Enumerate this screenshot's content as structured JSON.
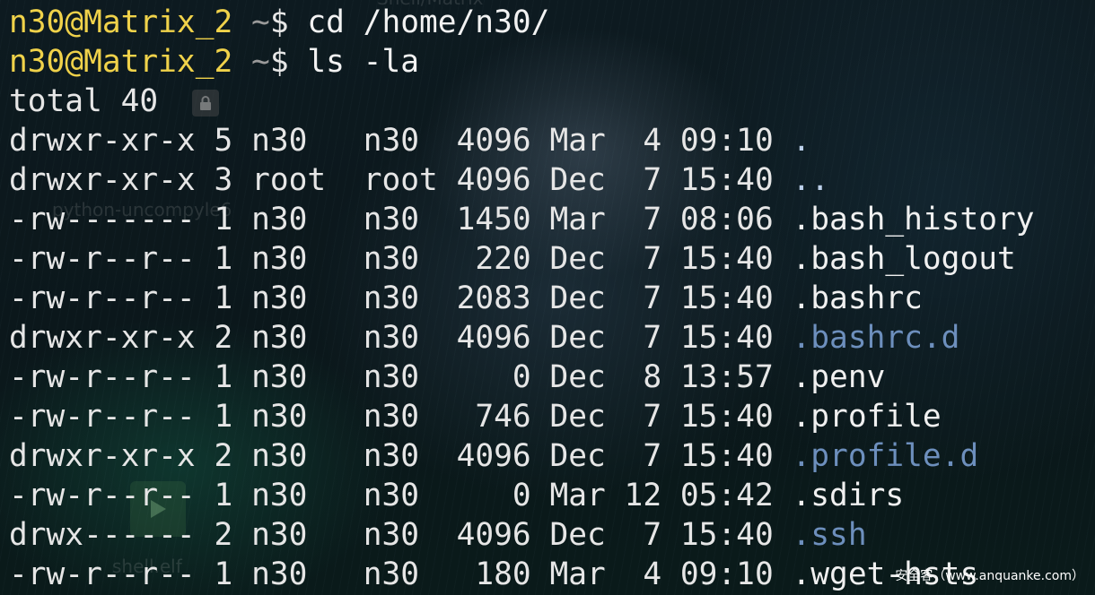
{
  "prompt": {
    "user_host": "n30@Matrix_2",
    "cwd": "~",
    "symbol": "$"
  },
  "commands": [
    "cd /home/n30/",
    "ls -la"
  ],
  "total_line": "total 40",
  "listing": [
    {
      "perms": "drwxr-xr-x",
      "links": "5",
      "owner": "n30",
      "group": "n30",
      "size": "4096",
      "month": "Mar",
      "day": "4",
      "time": "09:10",
      "name": ".",
      "kind": "dotdir"
    },
    {
      "perms": "drwxr-xr-x",
      "links": "3",
      "owner": "root",
      "group": "root",
      "size": "4096",
      "month": "Dec",
      "day": "7",
      "time": "15:40",
      "name": "..",
      "kind": "dotdir"
    },
    {
      "perms": "-rw-------",
      "links": "1",
      "owner": "n30",
      "group": "n30",
      "size": "1450",
      "month": "Mar",
      "day": "7",
      "time": "08:06",
      "name": ".bash_history",
      "kind": "file"
    },
    {
      "perms": "-rw-r--r--",
      "links": "1",
      "owner": "n30",
      "group": "n30",
      "size": "220",
      "month": "Dec",
      "day": "7",
      "time": "15:40",
      "name": ".bash_logout",
      "kind": "file"
    },
    {
      "perms": "-rw-r--r--",
      "links": "1",
      "owner": "n30",
      "group": "n30",
      "size": "2083",
      "month": "Dec",
      "day": "7",
      "time": "15:40",
      "name": ".bashrc",
      "kind": "file"
    },
    {
      "perms": "drwxr-xr-x",
      "links": "2",
      "owner": "n30",
      "group": "n30",
      "size": "4096",
      "month": "Dec",
      "day": "7",
      "time": "15:40",
      "name": ".bashrc.d",
      "kind": "dir"
    },
    {
      "perms": "-rw-r--r--",
      "links": "1",
      "owner": "n30",
      "group": "n30",
      "size": "0",
      "month": "Dec",
      "day": "8",
      "time": "13:57",
      "name": ".penv",
      "kind": "file"
    },
    {
      "perms": "-rw-r--r--",
      "links": "1",
      "owner": "n30",
      "group": "n30",
      "size": "746",
      "month": "Dec",
      "day": "7",
      "time": "15:40",
      "name": ".profile",
      "kind": "file"
    },
    {
      "perms": "drwxr-xr-x",
      "links": "2",
      "owner": "n30",
      "group": "n30",
      "size": "4096",
      "month": "Dec",
      "day": "7",
      "time": "15:40",
      "name": ".profile.d",
      "kind": "dir"
    },
    {
      "perms": "-rw-r--r--",
      "links": "1",
      "owner": "n30",
      "group": "n30",
      "size": "0",
      "month": "Mar",
      "day": "12",
      "time": "05:42",
      "name": ".sdirs",
      "kind": "file"
    },
    {
      "perms": "drwx------",
      "links": "2",
      "owner": "n30",
      "group": "n30",
      "size": "4096",
      "month": "Dec",
      "day": "7",
      "time": "15:40",
      "name": ".ssh",
      "kind": "dir"
    },
    {
      "perms": "-rw-r--r--",
      "links": "1",
      "owner": "n30",
      "group": "n30",
      "size": "180",
      "month": "Mar",
      "day": "4",
      "time": "09:10",
      "name": ".wget-hsts",
      "kind": "file"
    }
  ],
  "background": {
    "top_label": "Shell/Matrix",
    "desktop_labels": [
      "python-uncompyle6",
      "shell.elf"
    ],
    "icons": [
      "lock-icon",
      "play-icon"
    ]
  },
  "watermark": "安全客（www.anquanke.com）",
  "colors": {
    "prompt": "#f0d24a",
    "tilde_path": "#9a9a9a",
    "text": "#e6e6e6",
    "dir_name": "#6d8fbd",
    "dotdir_name": "#bcd0ea"
  }
}
